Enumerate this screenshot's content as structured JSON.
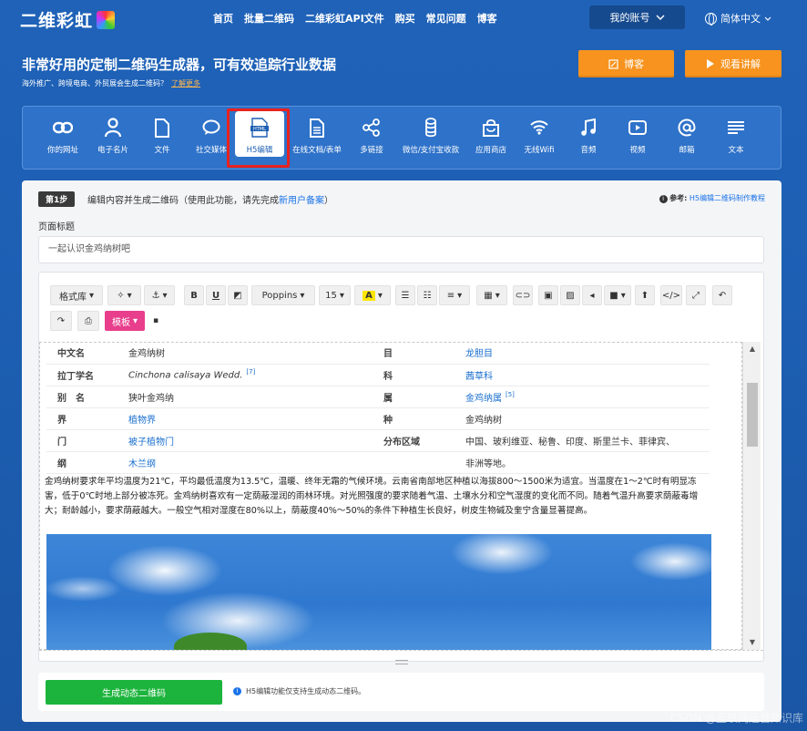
{
  "brand": {
    "name": "二维彩虹"
  },
  "nav": {
    "items": [
      "首页",
      "批量二维码",
      "二维彩虹API文件",
      "购买",
      "常见问题",
      "博客"
    ],
    "account": "我的账号",
    "language": "简体中文"
  },
  "hero": {
    "title": "非常好用的定制二维码生成器，可有效追踪行业数据",
    "subtitle": "海外推广、跨境电商、外贸展会生成二维码？",
    "learn_more": "了解更多",
    "blog_button": "博客",
    "video_button": "观看讲解"
  },
  "categories": [
    {
      "label": "你的网址",
      "icon": "link-icon"
    },
    {
      "label": "电子名片",
      "icon": "person-icon"
    },
    {
      "label": "文件",
      "icon": "file-icon"
    },
    {
      "label": "社交媒体",
      "icon": "chat-icon"
    },
    {
      "label": "H5编辑",
      "icon": "html-icon"
    },
    {
      "label": "在线文档/表单",
      "icon": "document-icon"
    },
    {
      "label": "多链接",
      "icon": "share-icon"
    },
    {
      "label": "微信/支付宝收款",
      "icon": "coins-icon"
    },
    {
      "label": "应用商店",
      "icon": "store-icon"
    },
    {
      "label": "无线Wifi",
      "icon": "wifi-icon"
    },
    {
      "label": "音频",
      "icon": "music-icon"
    },
    {
      "label": "视频",
      "icon": "video-icon"
    },
    {
      "label": "邮箱",
      "icon": "at-icon"
    },
    {
      "label": "文本",
      "icon": "text-icon"
    }
  ],
  "step": {
    "badge": "第1步",
    "text": "编辑内容并生成二维码（使用此功能，请先完成",
    "link": "新用户备案",
    "text_end": "）",
    "ref_label": "参考:",
    "ref_link": "H5编辑二维码制作教程"
  },
  "form": {
    "title_label": "页面标题",
    "title_value": "一起认识金鸡纳树吧"
  },
  "toolbar": {
    "format": "格式库",
    "font": "Poppins",
    "size": "15",
    "template": "模板"
  },
  "table": [
    {
      "k": "中文名",
      "v": "金鸡纳树",
      "k2": "目",
      "v2": "龙胆目",
      "v2_link": true
    },
    {
      "k": "拉丁学名",
      "v": "Cinchona calisaya Wedd.",
      "v_sup": "[7]",
      "k2": "科",
      "v2": "茜草科",
      "v2_link": true
    },
    {
      "k": "别　名",
      "v": "狭叶金鸡纳",
      "k2": "属",
      "v2": "金鸡纳属",
      "v2_link": true,
      "v2_sup": "[5]"
    },
    {
      "k": "界",
      "v": "植物界",
      "v_link": true,
      "k2": "种",
      "v2": "金鸡纳树"
    },
    {
      "k": "门",
      "v": "被子植物门",
      "v_link": true,
      "k2": "分布区域",
      "v2": "中国、玻利维亚、秘鲁、印度、斯里兰卡、菲律宾、"
    },
    {
      "k": "纲",
      "v": "木兰纲",
      "v_link": true,
      "k2": "",
      "v2": "非洲等地。"
    }
  ],
  "paragraph": "金鸡纳树要求年平均温度为21℃，平均最低温度为13.5℃，温暖、终年无霜的气候环境。云南省南部地区种植以海拔800～1500米为适宜。当温度在1～2℃时有明显冻害，低于0℃时地上部分被冻死。金鸡纳树喜欢有一定荫蔽湿润的雨林环境。对光照强度的要求随着气温、土壤水分和空气湿度的变化而不同。随着气温升高要求荫蔽毒增大；耐龄越小，要求荫蔽越大。一般空气相对湿度在80%以上，荫蔽度40%～50%的条件下种植生长良好，树皮生物碱及奎宁含量显著提高。",
  "generate": {
    "button": "生成动态二维码",
    "note": "H5编辑功能仅支持生成动态二维码。"
  },
  "watermark": "CSDN @互联网运营知识库"
}
